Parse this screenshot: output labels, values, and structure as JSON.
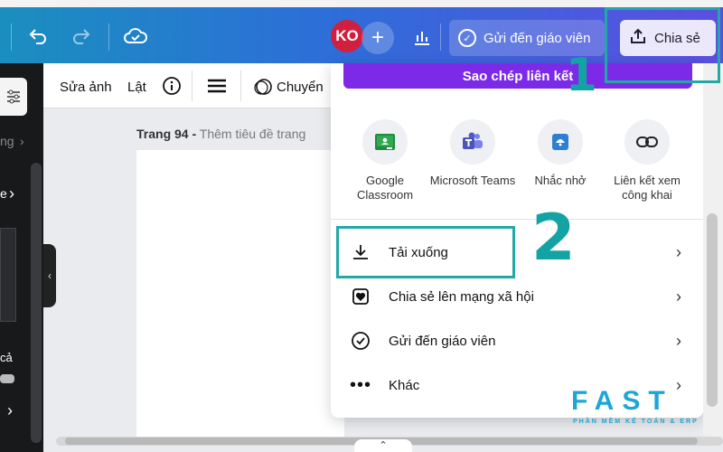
{
  "topbar": {
    "undo_icon": "undo-icon",
    "redo_icon": "redo-icon",
    "cloud_icon": "cloud-check-icon",
    "avatar_initials": "KO",
    "add_icon": "plus-icon",
    "chart_icon": "chart-icon",
    "send_teacher_label": "Gửi đến giáo viên",
    "share_label": "Chia sẻ"
  },
  "editor_toolbar": {
    "edit_photo": "Sửa ảnh",
    "flip": "Lật",
    "transition": "Chuyển"
  },
  "left_panel": {
    "item1": "ng",
    "item2": "e",
    "item3": "cả"
  },
  "page": {
    "number": "Trang 94 -",
    "title_placeholder": "Thêm tiêu đề trang"
  },
  "share_menu": {
    "copy_link": "Sao chép liên kết",
    "apps": [
      {
        "label": "Google Classroom",
        "icon": "google-classroom-icon"
      },
      {
        "label": "Microsoft Teams",
        "icon": "microsoft-teams-icon"
      },
      {
        "label": "Nhắc nhở",
        "icon": "reminder-icon"
      },
      {
        "label": "Liên kết xem công khai",
        "icon": "public-link-icon"
      }
    ],
    "items": [
      {
        "label": "Tải xuống",
        "icon": "download-icon"
      },
      {
        "label": "Chia sẻ lên mạng xã hội",
        "icon": "social-heart-icon"
      },
      {
        "label": "Gửi đến giáo viên",
        "icon": "check-circle-icon"
      },
      {
        "label": "Khác",
        "icon": "more-icon"
      }
    ]
  },
  "annotations": {
    "step1": "1",
    "step2": "2"
  },
  "watermark": {
    "brand": "FAST",
    "tagline": "PHẦN MỀM KẾ TOÁN & ERP"
  },
  "colors": {
    "accent_purple": "#7d2ae8",
    "annotation_teal": "#14a3a5",
    "avatar_red": "#d11f3f"
  }
}
